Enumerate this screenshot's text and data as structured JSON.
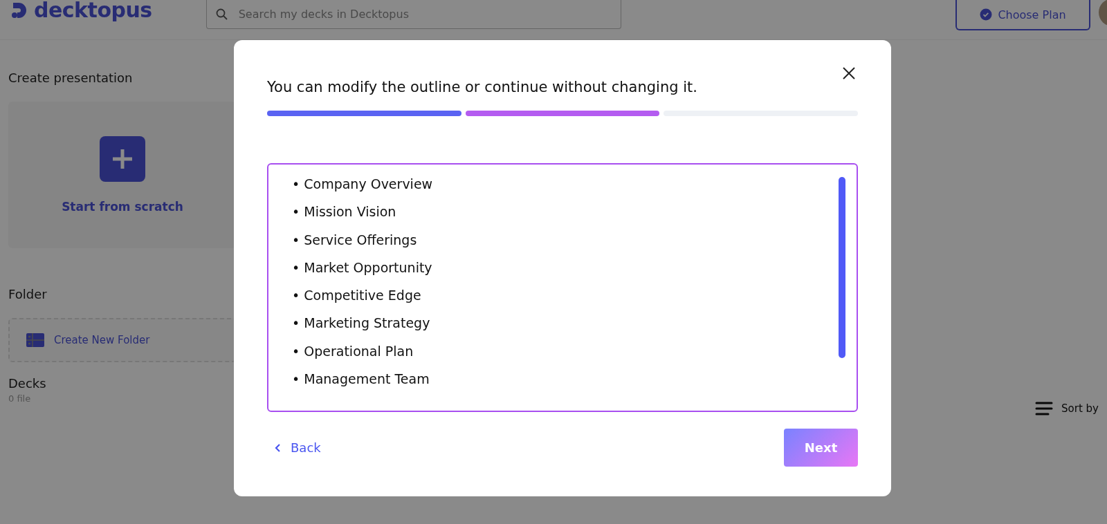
{
  "header": {
    "logo": "decktopus",
    "search": {
      "placeholder": "Search my decks in Decktopus"
    },
    "plan_button": "Choose Plan"
  },
  "create": {
    "heading": "Create presentation",
    "card_label": "Start from scratch"
  },
  "folder": {
    "heading": "Folder",
    "new_folder": "Create New Folder"
  },
  "decks": {
    "heading": "Decks",
    "count": "0 file",
    "sort": "Sort by"
  },
  "modal": {
    "title": "You can modify the outline or continue without changing it.",
    "steps": [
      {
        "done": true,
        "color": "#5a63f2"
      },
      {
        "done": true,
        "color": "#b45cf0"
      },
      {
        "done": false
      }
    ],
    "outline": [
      "• Company Overview",
      "• Mission Vision",
      "• Service Offerings",
      "• Market Opportunity",
      "• Competitive Edge",
      "• Marketing Strategy",
      "• Operational Plan",
      "• Management Team"
    ],
    "back": "Back",
    "next": "Next"
  }
}
